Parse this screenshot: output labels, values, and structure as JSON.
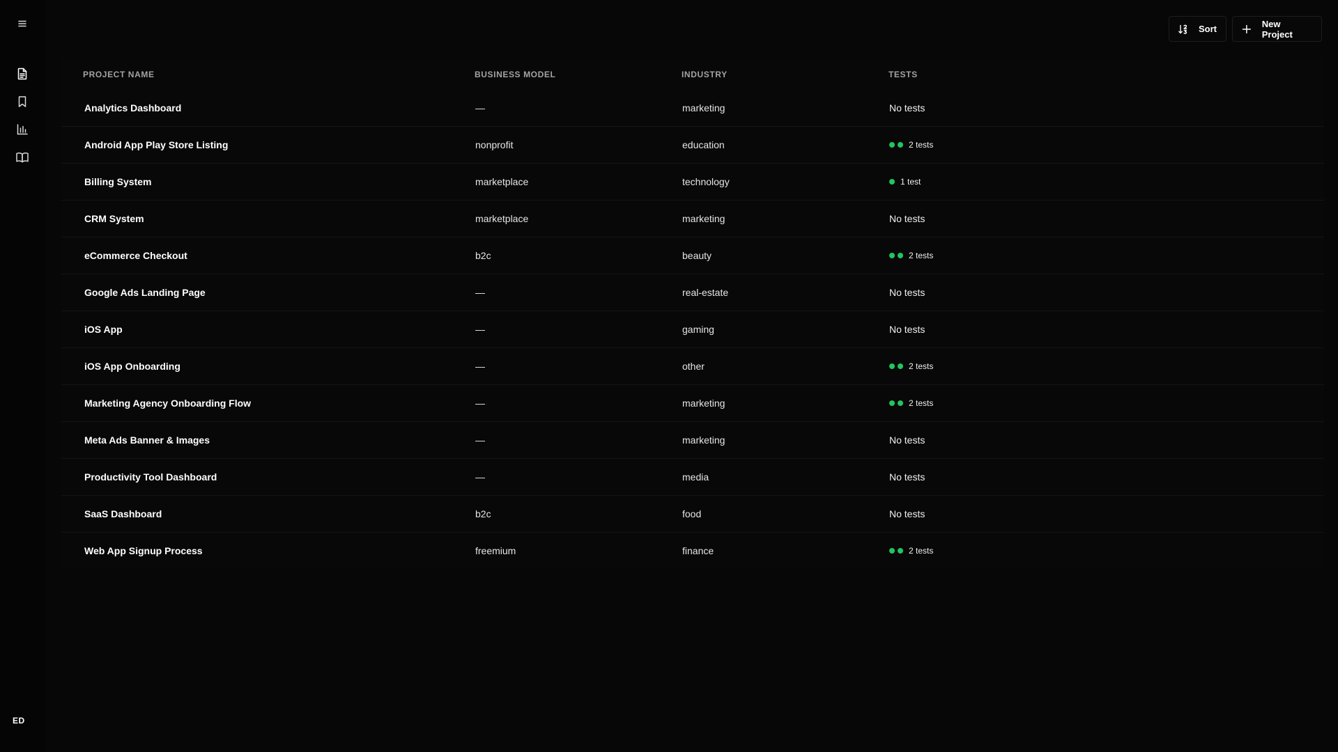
{
  "sidebar": {
    "menu_icon": "menu-icon",
    "nav": [
      {
        "name": "document-icon",
        "active": true
      },
      {
        "name": "bookmark-icon",
        "active": false
      },
      {
        "name": "bar-chart-icon",
        "active": false
      },
      {
        "name": "book-icon",
        "active": false
      }
    ],
    "avatar_initials": "ED"
  },
  "toolbar": {
    "sort_label": "Sort",
    "new_project_label": "New Project"
  },
  "table": {
    "headers": {
      "name": "PROJECT NAME",
      "business_model": "BUSINESS MODEL",
      "industry": "INDUSTRY",
      "tests": "TESTS"
    },
    "rows": [
      {
        "name": "Analytics Dashboard",
        "business_model": "—",
        "industry": "marketing",
        "tests_count": 0,
        "tests_label": "No tests"
      },
      {
        "name": "Android App Play Store Listing",
        "business_model": "nonprofit",
        "industry": "education",
        "tests_count": 2,
        "tests_label": "2 tests"
      },
      {
        "name": "Billing System",
        "business_model": "marketplace",
        "industry": "technology",
        "tests_count": 1,
        "tests_label": "1 test"
      },
      {
        "name": "CRM System",
        "business_model": "marketplace",
        "industry": "marketing",
        "tests_count": 0,
        "tests_label": "No tests"
      },
      {
        "name": "eCommerce Checkout",
        "business_model": "b2c",
        "industry": "beauty",
        "tests_count": 2,
        "tests_label": "2 tests"
      },
      {
        "name": "Google Ads Landing Page",
        "business_model": "—",
        "industry": "real-estate",
        "tests_count": 0,
        "tests_label": "No tests"
      },
      {
        "name": "iOS App",
        "business_model": "—",
        "industry": "gaming",
        "tests_count": 0,
        "tests_label": "No tests"
      },
      {
        "name": "iOS App Onboarding",
        "business_model": "—",
        "industry": "other",
        "tests_count": 2,
        "tests_label": "2 tests"
      },
      {
        "name": "Marketing Agency Onboarding Flow",
        "business_model": "—",
        "industry": "marketing",
        "tests_count": 2,
        "tests_label": "2 tests"
      },
      {
        "name": "Meta Ads Banner & Images",
        "business_model": "—",
        "industry": "marketing",
        "tests_count": 0,
        "tests_label": "No tests"
      },
      {
        "name": "Productivity Tool Dashboard",
        "business_model": "—",
        "industry": "media",
        "tests_count": 0,
        "tests_label": "No tests"
      },
      {
        "name": "SaaS Dashboard",
        "business_model": "b2c",
        "industry": "food",
        "tests_count": 0,
        "tests_label": "No tests"
      },
      {
        "name": "Web App Signup Process",
        "business_model": "freemium",
        "industry": "finance",
        "tests_count": 2,
        "tests_label": "2 tests"
      }
    ]
  },
  "colors": {
    "background": "#070707",
    "test_dot": "#22c55e"
  }
}
